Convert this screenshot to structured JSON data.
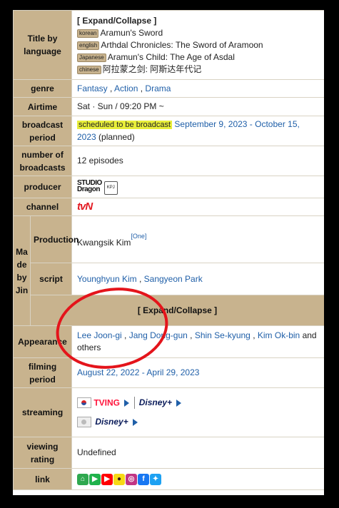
{
  "title_label": "Title by language",
  "title_toggle": "[ Expand/Collapse ]",
  "titles": [
    {
      "lang": "korean",
      "text": "Aramun's Sword"
    },
    {
      "lang": "english",
      "text": "Arthdal Chronicles: The Sword of Aramoon"
    },
    {
      "lang": "Japanese",
      "text": "Aramun's Child: The Age of Asdal"
    },
    {
      "lang": "chinese",
      "text": "阿拉蒙之剑: 阿斯达年代记"
    }
  ],
  "genre_label": "genre",
  "genres": [
    "Fantasy",
    "Action",
    "Drama"
  ],
  "airtime_label": "Airtime",
  "airtime": "Sat · Sun / 09:20 PM ~",
  "broadcast_label": "broadcast period",
  "broadcast_badge": "scheduled to be broadcast",
  "broadcast_dates": "September 9, 2023 - October 15, 2023",
  "broadcast_note": "(planned)",
  "episodes_label": "number of broadcasts",
  "episodes": "12 episodes",
  "producer_label": "producer",
  "producer_logo_line1": "STUDIO",
  "producer_logo_line2": "Dragon",
  "producer_logo_small": "KPJ",
  "channel_label": "channel",
  "channel_logo": "tvN",
  "made_by_label": "Made by Jin",
  "production_label": "Production",
  "production_value": "Kwangsik Kim",
  "production_sup": "[One]",
  "script_label": "script",
  "script_writers": [
    "Younghyun Kim",
    "Sangyeon Park"
  ],
  "cast_toggle": "[ Expand/Collapse ]",
  "appearance_label": "Appearance",
  "cast": [
    "Lee Joon-gi",
    "Jang Dong-gun",
    "Shin Se-kyung",
    "Kim Ok-bin"
  ],
  "cast_suffix": "and others",
  "filming_label": "filming period",
  "filming_dates": "August 22, 2022 - April 29, 2023",
  "streaming_label": "streaming",
  "streaming": {
    "service_1": "TVING",
    "service_2": "Disney+",
    "service_3": "Disney+"
  },
  "rating_label": "viewing rating",
  "rating": "Undefined",
  "link_label": "link",
  "links": [
    {
      "icon": "home-icon",
      "glyph": "⌂",
      "color": "#2fa84f"
    },
    {
      "icon": "play-icon",
      "glyph": "▶",
      "color": "#20b24b"
    },
    {
      "icon": "youtube-icon",
      "glyph": "▶",
      "color": "#ff0000"
    },
    {
      "icon": "kakao-icon",
      "glyph": "●",
      "color": "#f7d915"
    },
    {
      "icon": "instagram-icon",
      "glyph": "◎",
      "color": "#c13584"
    },
    {
      "icon": "facebook-icon",
      "glyph": "f",
      "color": "#1877f2"
    },
    {
      "icon": "twitter-icon",
      "glyph": "✦",
      "color": "#1da1f2"
    }
  ],
  "colors": {
    "header_bg": "#c8b38e",
    "link": "#1f5fa8",
    "badge": "#e8ee3a",
    "annotation_circle": "#e4141b"
  }
}
